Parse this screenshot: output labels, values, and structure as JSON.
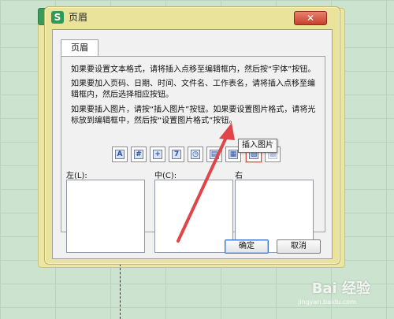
{
  "dialog": {
    "title": "页眉",
    "app_icon": "S",
    "close_glyph": "✕",
    "tab_label": "页眉"
  },
  "instructions": {
    "line1": "如果要设置文本格式，请将插入点移至编辑框内，然后按“字体”按钮。",
    "line2": "如果要加入页码、日期、时间、文件名、工作表名，请将插入点移至编辑框内，然后选择相应按钮。",
    "line3": "如果要插入图片，请按“插入图片”按钮。如果要设置图片格式，请将光标放到编辑框中，然后按“设置图片格式”按钮。"
  },
  "toolbar": {
    "buttons": [
      {
        "icon": "font-icon",
        "glyph": "A"
      },
      {
        "icon": "page-number-icon",
        "glyph": "#"
      },
      {
        "icon": "total-pages-icon",
        "glyph": "+"
      },
      {
        "icon": "date-icon",
        "glyph": "7"
      },
      {
        "icon": "time-icon",
        "glyph": "◷"
      },
      {
        "icon": "file-name-icon",
        "glyph": "▤"
      },
      {
        "icon": "sheet-name-icon",
        "glyph": "▦"
      },
      {
        "icon": "insert-picture-icon",
        "glyph": "▨"
      },
      {
        "icon": "format-picture-icon",
        "glyph": "▩"
      }
    ]
  },
  "sections": {
    "left_label": "左(L):",
    "center_label": "中(C):",
    "right_label": "右"
  },
  "tooltip": "插入图片",
  "buttons": {
    "ok": "确定",
    "cancel": "取消"
  },
  "watermark": {
    "brand": "Bai 经验",
    "url": "jingyan.baidu.com"
  },
  "colors": {
    "dialog_frame": "#e9e39c",
    "highlight": "#e24b4b",
    "arrow": "#e0454a"
  }
}
